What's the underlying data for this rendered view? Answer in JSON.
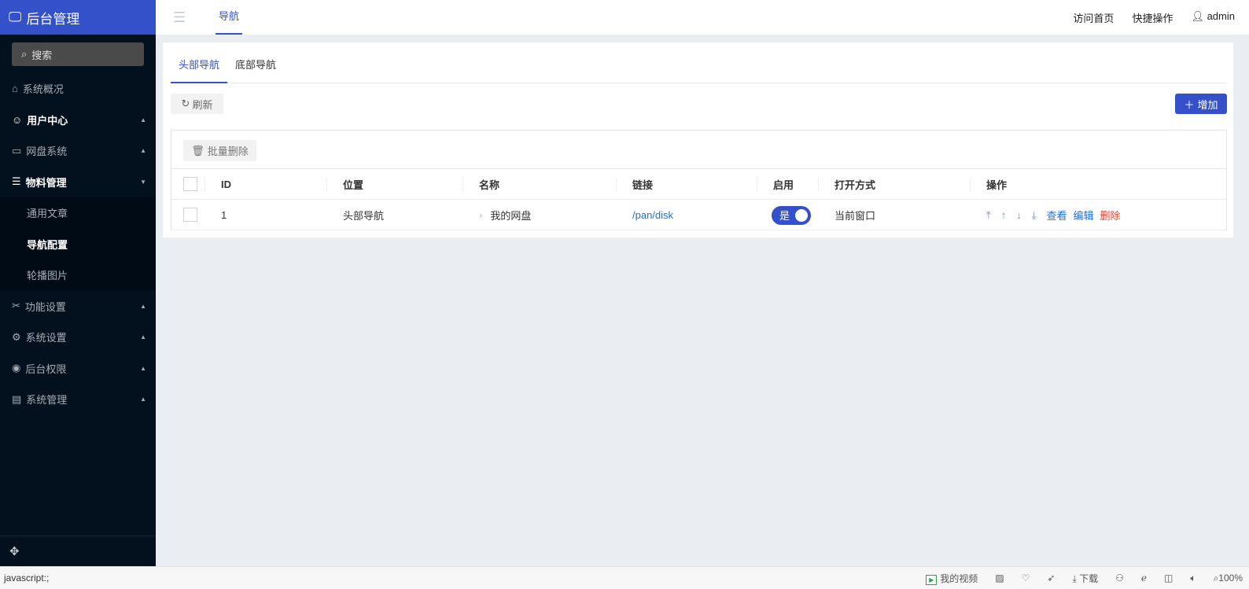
{
  "sidebar": {
    "title": "后台管理",
    "search": "搜索",
    "items": [
      {
        "label": "系统概况"
      },
      {
        "label": "用户中心"
      },
      {
        "label": "网盘系统"
      },
      {
        "label": "物料管理"
      }
    ],
    "sub": [
      {
        "label": "通用文章"
      },
      {
        "label": "导航配置"
      },
      {
        "label": "轮播图片"
      }
    ],
    "items2": [
      {
        "label": "功能设置"
      },
      {
        "label": "系统设置"
      },
      {
        "label": "后台权限"
      },
      {
        "label": "系统管理"
      }
    ]
  },
  "topbar": {
    "tab": "导航",
    "links": [
      "访问首页",
      "快捷操作",
      "admin"
    ]
  },
  "tabs": [
    "头部导航",
    "底部导航"
  ],
  "toolbar": {
    "refresh": "刷新",
    "add": "增加",
    "batch_delete": "批量删除"
  },
  "table": {
    "headers": [
      "ID",
      "位置",
      "名称",
      "链接",
      "启用",
      "打开方式",
      "操作"
    ],
    "rows": [
      {
        "id": "1",
        "position": "头部导航",
        "name": "我的网盘",
        "link": "/pan/disk",
        "enabled": "是",
        "open": "当前窗口",
        "view": "查看",
        "edit": "编辑",
        "delete": "删除"
      }
    ]
  },
  "status": {
    "left": "javascript:;",
    "video": "我的视频",
    "download": "下载",
    "zoom": "100%"
  }
}
